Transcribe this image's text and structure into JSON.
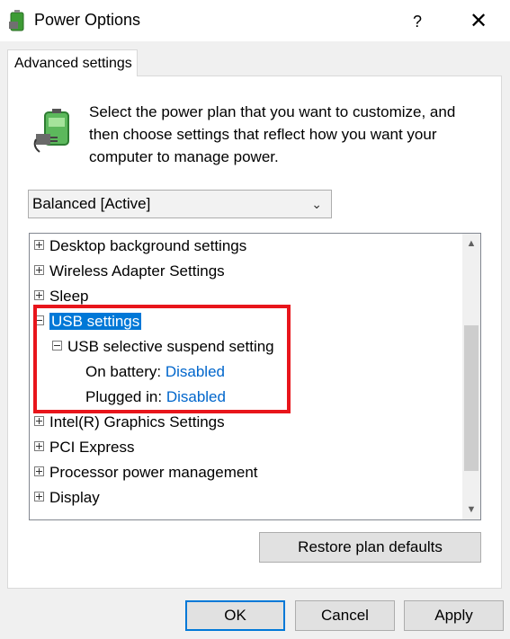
{
  "window": {
    "title": "Power Options",
    "help_label": "?",
    "close_label": "✕"
  },
  "tab": {
    "label": "Advanced settings"
  },
  "intro": {
    "text": "Select the power plan that you want to customize, and then choose settings that reflect how you want your computer to manage power."
  },
  "plan_select": {
    "value": "Balanced [Active]"
  },
  "tree": {
    "items": [
      {
        "label": "Desktop background settings",
        "expander": "plus"
      },
      {
        "label": "Wireless Adapter Settings",
        "expander": "plus"
      },
      {
        "label": "Sleep",
        "expander": "plus"
      },
      {
        "label": "USB settings",
        "expander": "minus",
        "selected": true
      },
      {
        "label": "USB selective suspend setting",
        "expander": "minus"
      },
      {
        "label": "On battery:",
        "value": "Disabled"
      },
      {
        "label": "Plugged in:",
        "value": "Disabled"
      },
      {
        "label": "Intel(R) Graphics Settings",
        "expander": "plus"
      },
      {
        "label": "PCI Express",
        "expander": "plus"
      },
      {
        "label": "Processor power management",
        "expander": "plus"
      },
      {
        "label": "Display",
        "expander": "plus"
      }
    ]
  },
  "buttons": {
    "restore": "Restore plan defaults",
    "ok": "OK",
    "cancel": "Cancel",
    "apply": "Apply"
  },
  "colors": {
    "selection": "#0078d7",
    "highlight_border": "#e8151b",
    "link": "#0066cc"
  }
}
